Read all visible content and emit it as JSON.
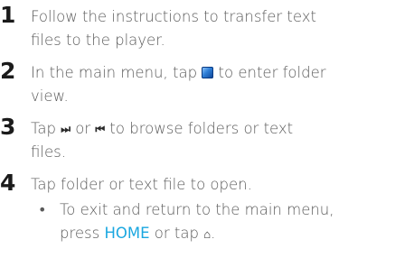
{
  "steps": [
    {
      "number": "1",
      "line1": "Follow the instructions to transfer text",
      "line2": "files to the player."
    },
    {
      "number": "2",
      "line1_before": "In the main menu, tap ",
      "line1_after": " to enter folder",
      "line2": "view.",
      "icon": "folder-view-icon"
    },
    {
      "number": "3",
      "line1_a": "Tap ",
      "next_glyph": "⏭",
      "line1_b": " or ",
      "prev_glyph": "⏮",
      "line1_c": " to browse folders or text",
      "line2": "files."
    },
    {
      "number": "4",
      "line1": "Tap folder or text file to open."
    }
  ],
  "substep": {
    "bullet": "•",
    "line1": "To exit and return to the main menu,",
    "line2_before": "press ",
    "keyword": "HOME",
    "line2_mid": " or tap ",
    "home_glyph": "⌂",
    "line2_after": ".",
    "keyword_color": "#1aa7e0"
  }
}
